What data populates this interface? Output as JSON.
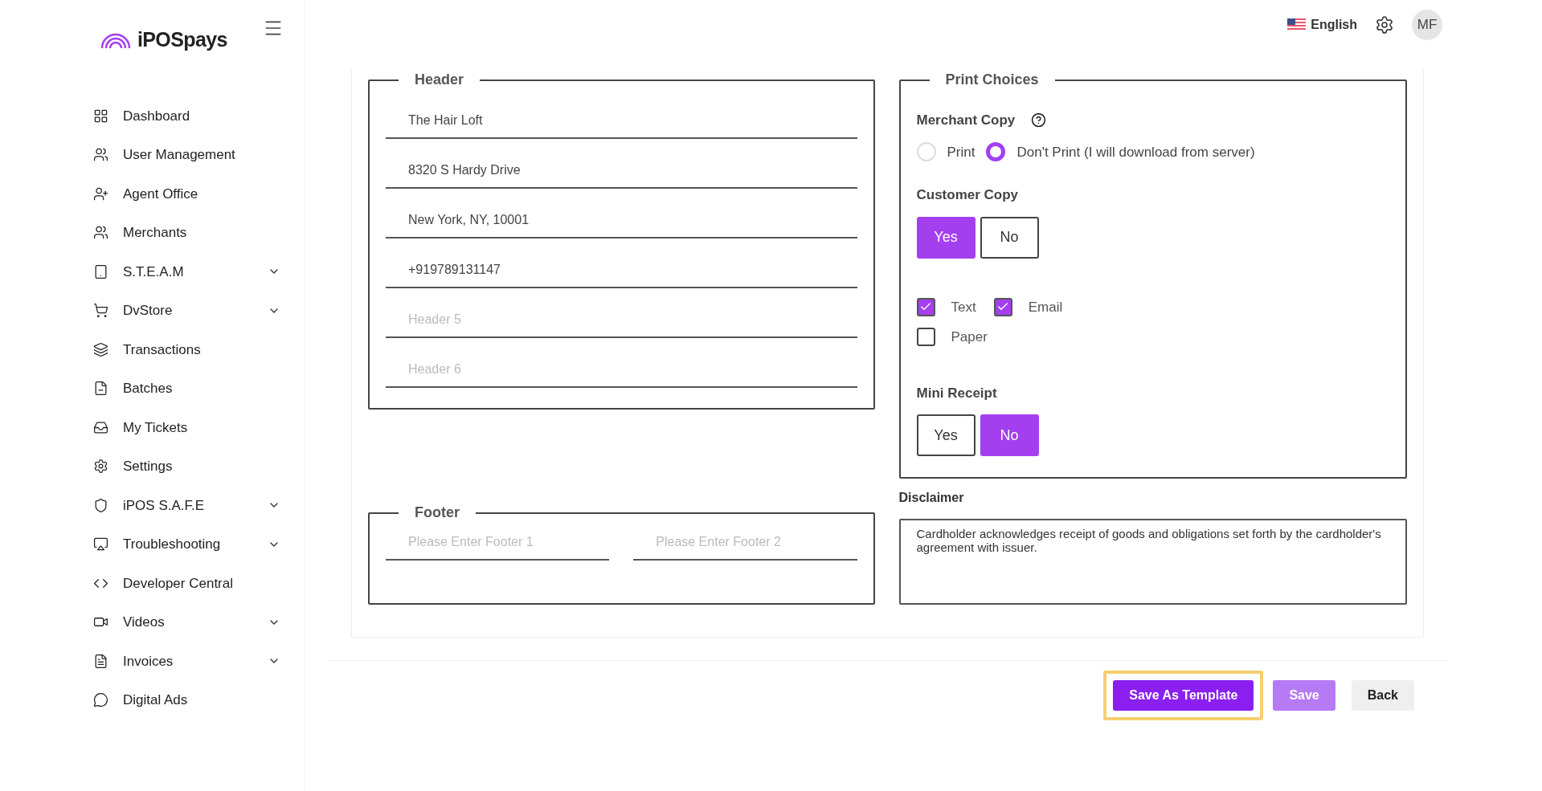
{
  "brand": {
    "name": "iPOSpays"
  },
  "sidebar": {
    "items": [
      {
        "label": "Dashboard",
        "has_submenu": false
      },
      {
        "label": "User Management",
        "has_submenu": false
      },
      {
        "label": "Agent Office",
        "has_submenu": false
      },
      {
        "label": "Merchants",
        "has_submenu": false
      },
      {
        "label": "S.T.E.A.M",
        "has_submenu": true
      },
      {
        "label": "DvStore",
        "has_submenu": true
      },
      {
        "label": "Transactions",
        "has_submenu": false
      },
      {
        "label": "Batches",
        "has_submenu": false
      },
      {
        "label": "My Tickets",
        "has_submenu": false
      },
      {
        "label": "Settings",
        "has_submenu": false
      },
      {
        "label": "iPOS S.A.F.E",
        "has_submenu": true
      },
      {
        "label": "Troubleshooting",
        "has_submenu": true
      },
      {
        "label": "Developer Central",
        "has_submenu": false
      },
      {
        "label": "Videos",
        "has_submenu": true
      },
      {
        "label": "Invoices",
        "has_submenu": true
      },
      {
        "label": "Digital Ads",
        "has_submenu": false
      }
    ]
  },
  "topbar": {
    "language": "English",
    "avatar": "MF"
  },
  "header_section": {
    "legend": "Header",
    "fields": [
      {
        "value": "The Hair Loft"
      },
      {
        "value": "8320 S Hardy Drive"
      },
      {
        "value": "New York, NY, 10001"
      },
      {
        "value": "+919789131147"
      },
      {
        "placeholder": "Header 5"
      },
      {
        "placeholder": "Header 6"
      }
    ]
  },
  "footer_section": {
    "legend": "Footer",
    "fields": [
      {
        "placeholder": "Please Enter Footer 1"
      },
      {
        "placeholder": "Please Enter Footer 2"
      }
    ]
  },
  "print_choices": {
    "legend": "Print Choices",
    "merchant_copy": {
      "label": "Merchant Copy",
      "options": [
        {
          "label": "Print",
          "selected": false
        },
        {
          "label": "Don't Print (I will download from server)",
          "selected": true
        }
      ]
    },
    "customer_copy": {
      "label": "Customer Copy",
      "options": [
        {
          "label": "Yes",
          "selected": true
        },
        {
          "label": "No",
          "selected": false
        }
      ]
    },
    "delivery": [
      {
        "label": "Text",
        "checked": true
      },
      {
        "label": "Email",
        "checked": true
      },
      {
        "label": "Paper",
        "checked": false
      }
    ],
    "mini_receipt": {
      "label": "Mini Receipt",
      "options": [
        {
          "label": "Yes",
          "selected": false
        },
        {
          "label": "No",
          "selected": true
        }
      ]
    }
  },
  "disclaimer": {
    "label": "Disclaimer",
    "value": "Cardholder acknowledges receipt of goods and obligations set forth by the cardholder's agreement with issuer."
  },
  "actions": [
    {
      "label": "Save As Template",
      "kind": "primary",
      "highlighted": true
    },
    {
      "label": "Save",
      "kind": "secondary",
      "highlighted": false
    },
    {
      "label": "Back",
      "kind": "neutral",
      "highlighted": false
    }
  ]
}
